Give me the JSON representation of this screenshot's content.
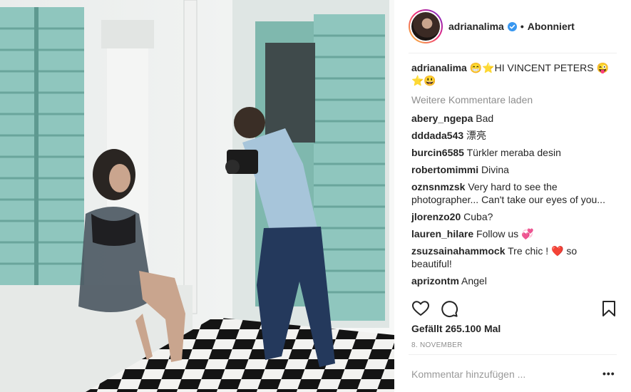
{
  "post": {
    "photo_description": "post-photo",
    "header": {
      "username": "adrianalima",
      "separator": "•",
      "follow_status": "Abonniert"
    },
    "caption": {
      "username": "adrianalima",
      "emoji_before": "😁⭐",
      "text": "HI VINCENT PETERS",
      "emoji_after": "😜",
      "emoji_line2": "⭐😃"
    },
    "load_more": "Weitere Kommentare laden",
    "comments": [
      {
        "user": "abery_ngepa",
        "text": "Bad"
      },
      {
        "user": "dddada543",
        "text": "漂亮"
      },
      {
        "user": "burcin6585",
        "text": "Türkler meraba desin"
      },
      {
        "user": "robertomimmi",
        "text": "Divina"
      },
      {
        "user": "oznsnmzsk",
        "text": "Very hard to see the photographer... Can't take our eyes of you..."
      },
      {
        "user": "jlorenzo20",
        "text": "Cuba?"
      },
      {
        "user": "lauren_hilare",
        "text": "Follow us 💞"
      },
      {
        "user": "zsuzsainahammock",
        "text": "Tre chic ! ❤️ so beautiful!"
      },
      {
        "user": "aprizontm",
        "text": "Angel"
      }
    ],
    "likes": "Gefällt 265.100 Mal",
    "date": "8. NOVEMBER",
    "comment_placeholder": "Kommentar hinzufügen ...",
    "more_label": "•••",
    "icons": {
      "like": "heart-icon",
      "comment": "comment-bubble-icon",
      "save": "bookmark-icon",
      "verified": "verified-badge-icon"
    },
    "colors": {
      "verified_blue": "#3897f0",
      "text": "#262626",
      "muted": "#8e8e8e"
    }
  }
}
